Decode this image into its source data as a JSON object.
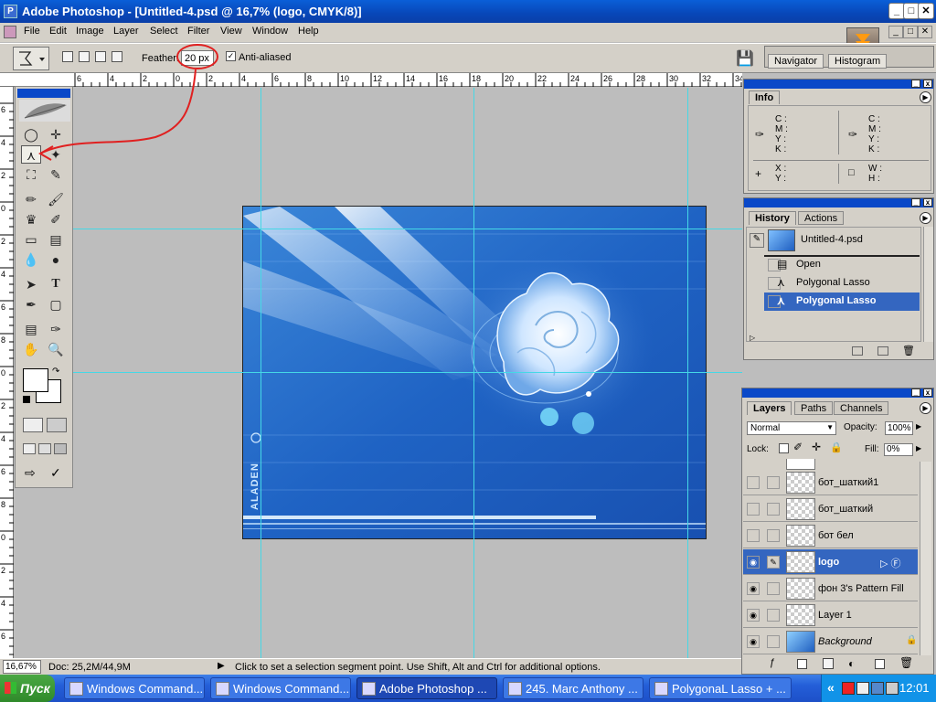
{
  "window": {
    "title": "Adobe Photoshop - [Untitled-4.psd @ 16,7% (logo, CMYK/8)]",
    "controls": [
      "_",
      "□",
      "✕"
    ]
  },
  "menu": [
    "File",
    "Edit",
    "Image",
    "Layer",
    "Select",
    "Filter",
    "View",
    "Window",
    "Help"
  ],
  "options": {
    "feather_label": "Feather:",
    "feather_value": "20 px",
    "antialiased_label": "Anti-aliased",
    "antialiased_checked": true,
    "well_tabs": [
      "Navigator",
      "Histogram"
    ]
  },
  "ruler_top_labels": [
    "6",
    "4",
    "2",
    "0",
    "2",
    "4",
    "6",
    "8",
    "10",
    "12",
    "14",
    "16",
    "18",
    "20",
    "22",
    "24",
    "26",
    "28",
    "30",
    "32",
    "34",
    "36"
  ],
  "ruler_left_labels": [
    "6",
    "4",
    "2",
    "0",
    "2",
    "4",
    "6",
    "8",
    "0",
    "2",
    "4",
    "6",
    "8",
    "0",
    "2",
    "4",
    "6",
    "8"
  ],
  "status": {
    "zoom": "16,67%",
    "doc": "Doc: 25,2M/44,9M",
    "hint": "Click to set a selection segment point.  Use Shift, Alt and Ctrl for additional options."
  },
  "canvas_text": "ALADEN",
  "info": {
    "tab": "Info",
    "c_label": "C :",
    "m_label": "M :",
    "y_label": "Y :",
    "k_label": "K :",
    "x_label": "X :",
    "yc_label": "Y :",
    "w_label": "W :",
    "h_label": "H :"
  },
  "history": {
    "tabs": [
      "History",
      "Actions"
    ],
    "snapshot": "Untitled-4.psd",
    "items": [
      {
        "label": "Open",
        "selected": false
      },
      {
        "label": "Polygonal Lasso",
        "selected": false
      },
      {
        "label": "Polygonal Lasso",
        "selected": true
      }
    ]
  },
  "layers": {
    "tabs": [
      "Layers",
      "Paths",
      "Channels"
    ],
    "blend_mode": "Normal",
    "opacity_label": "Opacity:",
    "opacity": "100%",
    "lock_label": "Lock:",
    "fill_label": "Fill:",
    "fill": "0%",
    "items": [
      {
        "name": "бот_шаткий1",
        "visible": false,
        "selected": false
      },
      {
        "name": "бот_шаткий",
        "visible": false,
        "selected": false
      },
      {
        "name": "бот    бел",
        "visible": false,
        "selected": false
      },
      {
        "name": "logo",
        "visible": true,
        "selected": true
      },
      {
        "name": "фон 3's Pattern Fill",
        "visible": true,
        "selected": false
      },
      {
        "name": "Layer 1",
        "visible": true,
        "selected": false
      },
      {
        "name": "Background",
        "visible": true,
        "selected": false
      }
    ]
  },
  "taskbar": {
    "start": "Пуск",
    "tasks": [
      {
        "label": "Windows Command...",
        "active": false
      },
      {
        "label": "Windows Command...",
        "active": false
      },
      {
        "label": "Adobe Photoshop ...",
        "active": true
      },
      {
        "label": "245. Marc Anthony ...",
        "active": false
      },
      {
        "label": "PolygonaL Lasso + ...",
        "active": false
      }
    ],
    "tray_arrow": "«",
    "clock": "12:01"
  },
  "colors": {
    "title_blue": "#0a48c8",
    "guide": "#45d8e6",
    "highlight": "#3466c0",
    "annotation": "#e02020"
  }
}
